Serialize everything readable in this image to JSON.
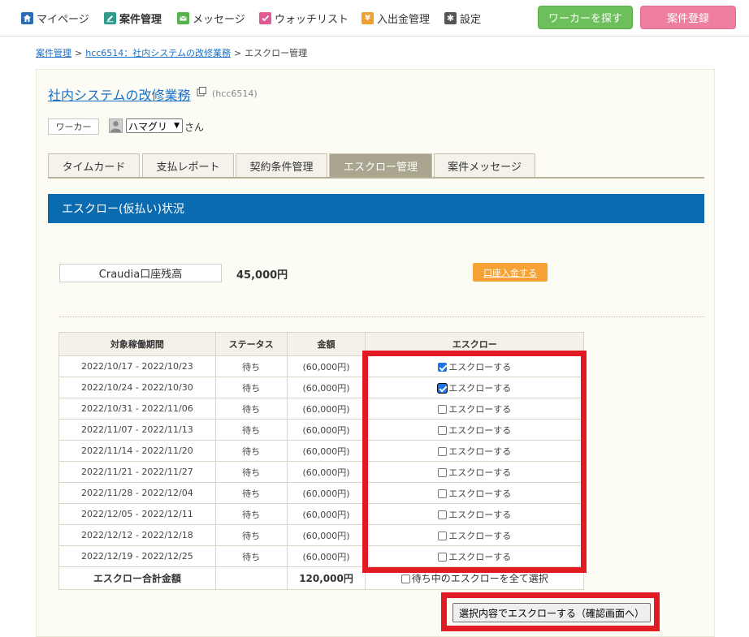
{
  "nav": {
    "items": [
      {
        "label": "マイページ",
        "icon": "home-icon",
        "color": "#2a6db3"
      },
      {
        "label": "案件管理",
        "icon": "edit-icon",
        "color": "#2f9b8c"
      },
      {
        "label": "メッセージ",
        "icon": "mail-icon",
        "color": "#55b14a"
      },
      {
        "label": "ウォッチリスト",
        "icon": "check-icon",
        "color": "#e05a94"
      },
      {
        "label": "入出金管理",
        "icon": "yen-icon",
        "color": "#f0a030"
      },
      {
        "label": "設定",
        "icon": "gear-icon",
        "color": "#555555"
      }
    ],
    "find_worker": "ワーカーを探す",
    "post_job": "案件登録"
  },
  "breadcrumb": {
    "item1": "案件管理",
    "item2": "hcc6514：社内システムの改修業務",
    "current": "エスクロー管理",
    "sep": ">"
  },
  "project": {
    "title": "社内システムの改修業務",
    "id": "(hcc6514)",
    "worker_tag": "ワーカー",
    "worker_name": "ハマグリ",
    "san": "さん"
  },
  "tabs": [
    "タイムカード",
    "支払レポート",
    "契約条件管理",
    "エスクロー管理",
    "案件メッセージ"
  ],
  "section_title": "エスクロー(仮払い)状況",
  "balance": {
    "label": "Craudia口座残高",
    "value": "45,000円",
    "deposit_button": "口座入金する"
  },
  "table": {
    "headers": [
      "対象稼働期間",
      "ステータス",
      "金額",
      "エスクロー"
    ],
    "rows": [
      {
        "period": "2022/10/17 - 2022/10/23",
        "status": "待ち",
        "amount": "(60,000円)",
        "escrow": "エスクローする",
        "checked": true
      },
      {
        "period": "2022/10/24 - 2022/10/30",
        "status": "待ち",
        "amount": "(60,000円)",
        "escrow": "エスクローする",
        "checked": true
      },
      {
        "period": "2022/10/31 - 2022/11/06",
        "status": "待ち",
        "amount": "(60,000円)",
        "escrow": "エスクローする",
        "checked": false
      },
      {
        "period": "2022/11/07 - 2022/11/13",
        "status": "待ち",
        "amount": "(60,000円)",
        "escrow": "エスクローする",
        "checked": false
      },
      {
        "period": "2022/11/14 - 2022/11/20",
        "status": "待ち",
        "amount": "(60,000円)",
        "escrow": "エスクローする",
        "checked": false
      },
      {
        "period": "2022/11/21 - 2022/11/27",
        "status": "待ち",
        "amount": "(60,000円)",
        "escrow": "エスクローする",
        "checked": false
      },
      {
        "period": "2022/11/28 - 2022/12/04",
        "status": "待ち",
        "amount": "(60,000円)",
        "escrow": "エスクローする",
        "checked": false
      },
      {
        "period": "2022/12/05 - 2022/12/11",
        "status": "待ち",
        "amount": "(60,000円)",
        "escrow": "エスクローする",
        "checked": false
      },
      {
        "period": "2022/12/12 - 2022/12/18",
        "status": "待ち",
        "amount": "(60,000円)",
        "escrow": "エスクローする",
        "checked": false
      },
      {
        "period": "2022/12/19 - 2022/12/25",
        "status": "待ち",
        "amount": "(60,000円)",
        "escrow": "エスクローする",
        "checked": false
      }
    ],
    "total_label": "エスクロー合計金額",
    "total_value": "120,000円",
    "select_all": "待ち中のエスクローを全て選択"
  },
  "submit_button": "選択内容でエスクローする（確認画面へ）",
  "colors": {
    "section_head": "#0a6bb0",
    "highlight": "#e21a23",
    "status": "#d24a2a",
    "link": "#1a6fc4"
  }
}
